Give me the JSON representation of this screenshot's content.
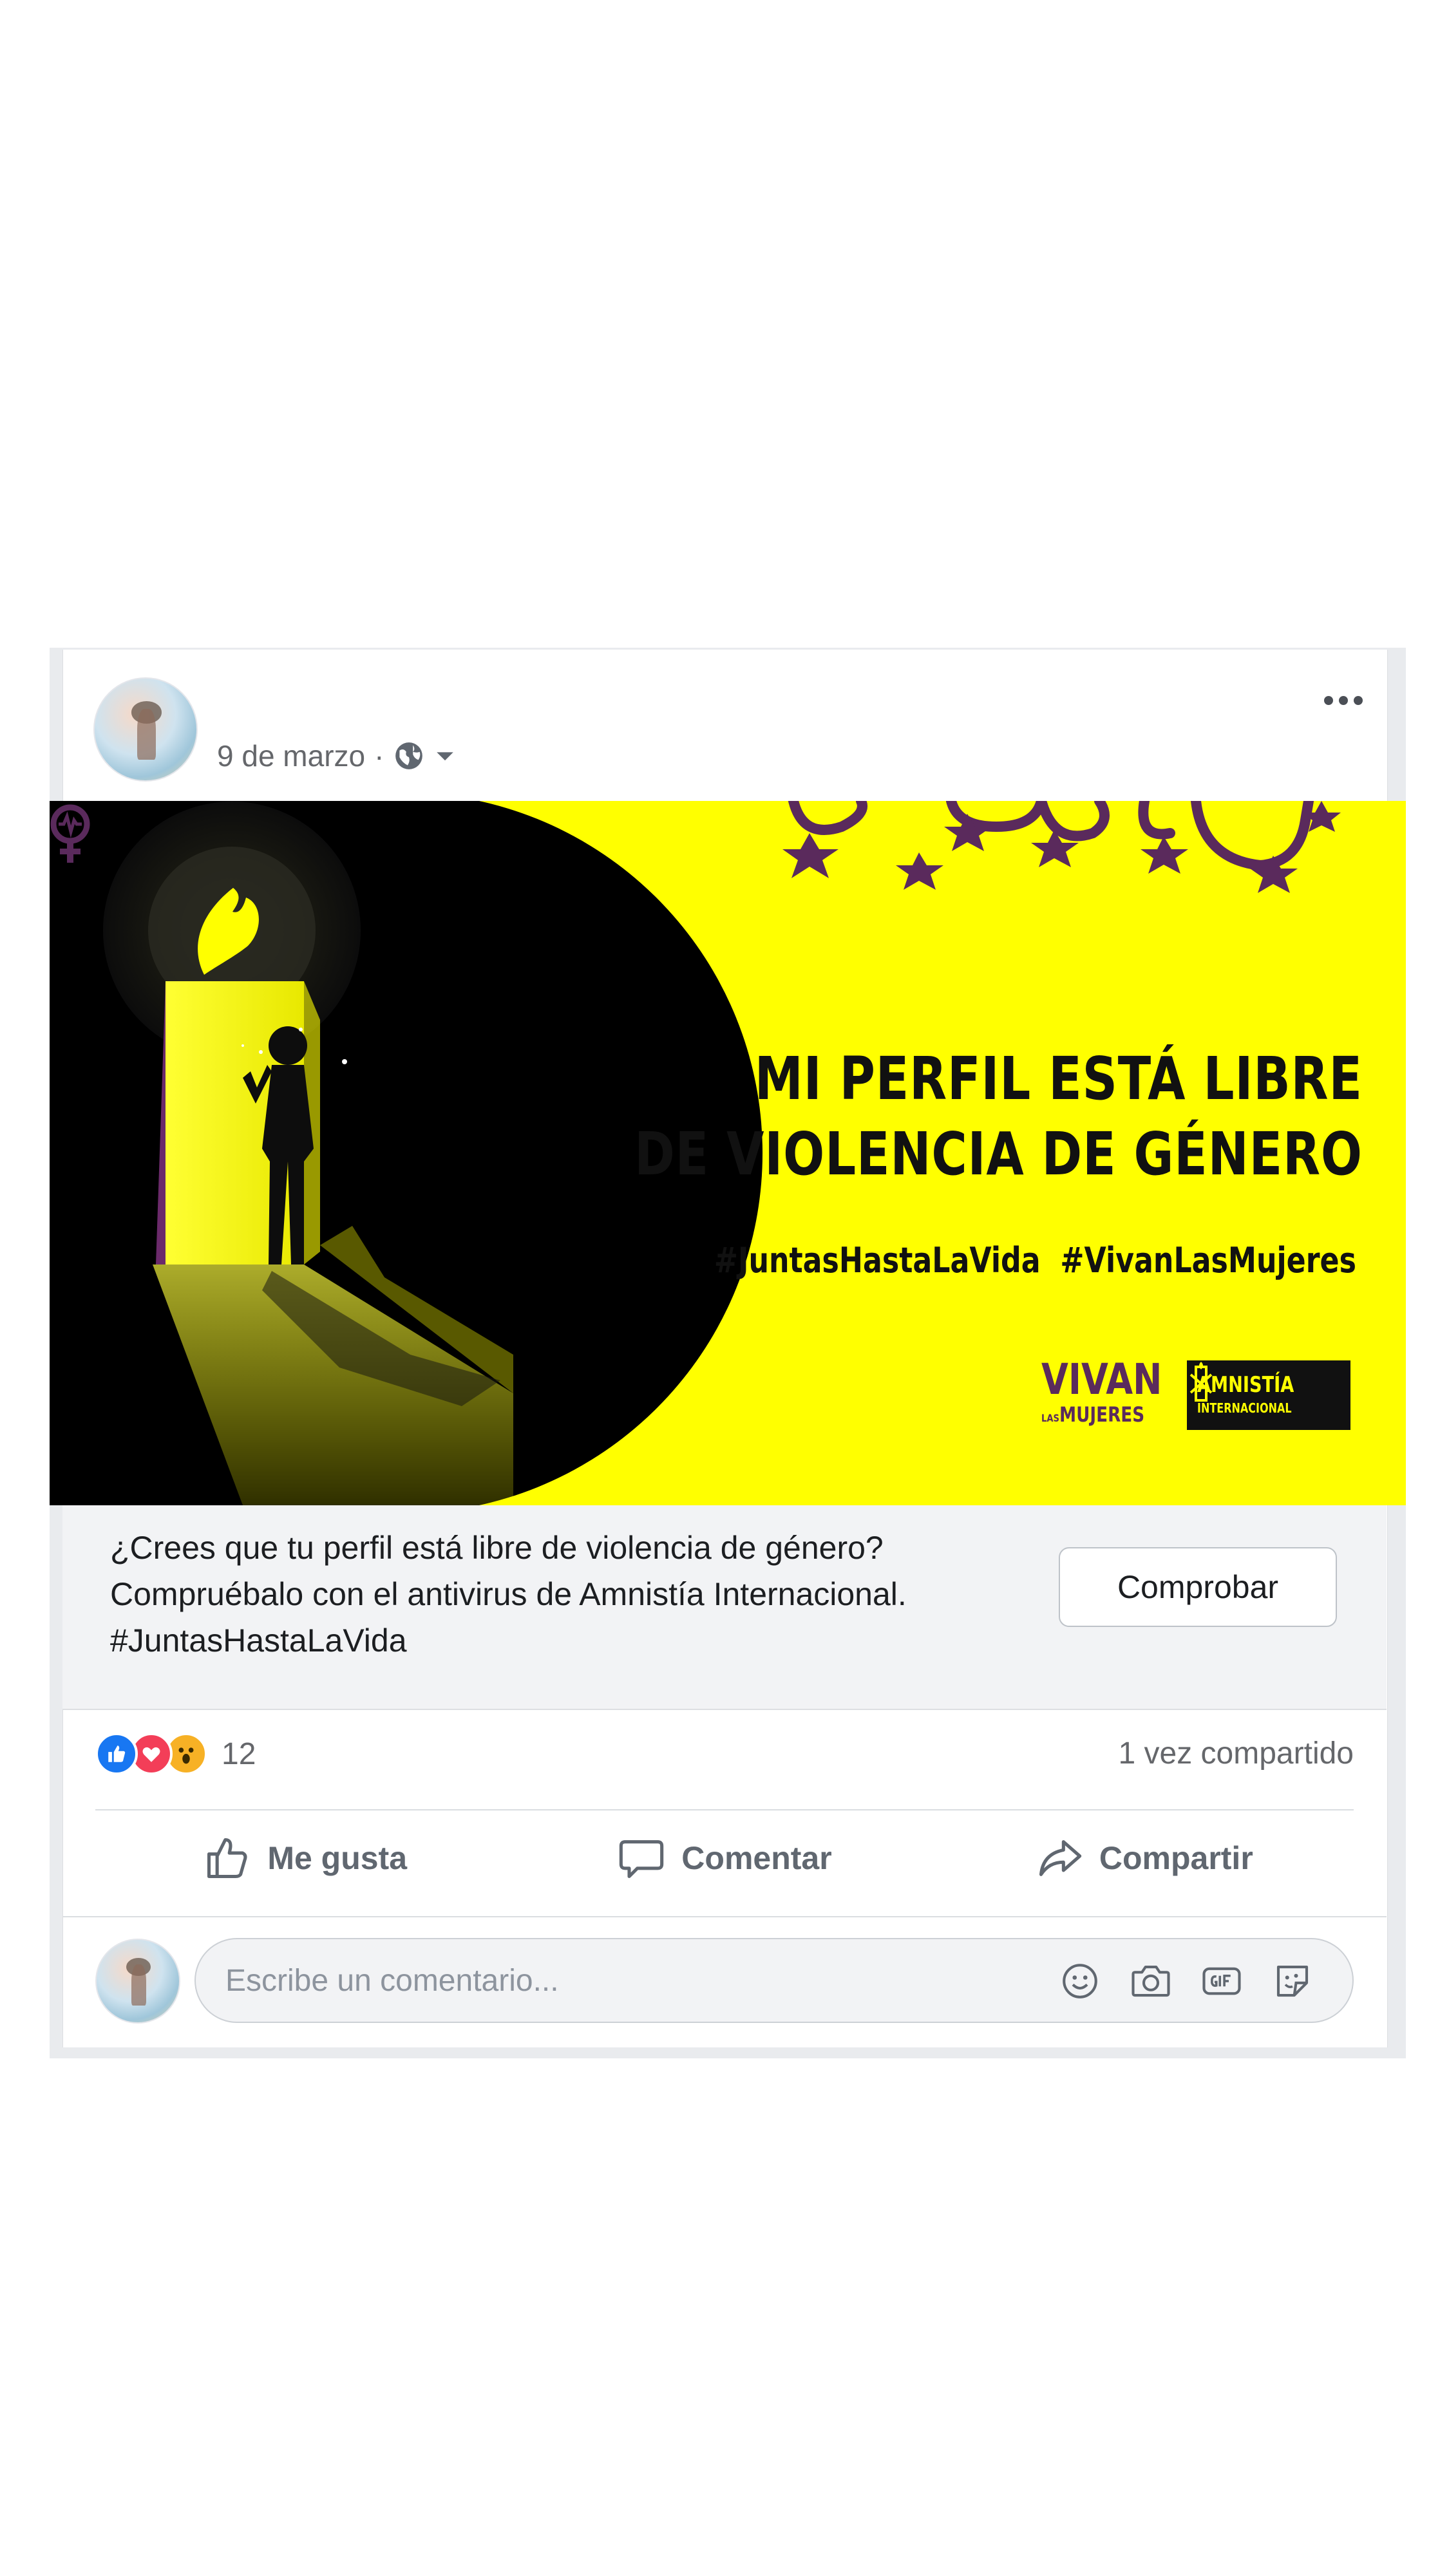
{
  "post": {
    "date": "9 de marzo",
    "separator": "·",
    "privacy_icon": "globe-icon",
    "privacy_menu_icon": "caret-down-icon",
    "more_icon": "more-options-icon"
  },
  "banner": {
    "headline_line1": "MI PERFIL ESTÁ LIBRE",
    "headline_line2": "DE VIOLENCIA DE GÉNERO",
    "hashtags": "#JuntasHastaLaVida  #VivanLasMujeres",
    "logo_vivan_main": "VIVAN",
    "logo_vivan_las": "LAS",
    "logo_vivan_sub": "MUJERES",
    "logo_amnesty_line1": "AMNISTÍA",
    "logo_amnesty_line2": "INTERNACIONAL",
    "colors": {
      "background": "#ffff00",
      "purple": "#5a2a5c",
      "dark": "#111111"
    }
  },
  "description": {
    "line1": "¿Crees que tu perfil está libre de violencia de género?",
    "line2": "Compruébalo con el antivirus de Amnistía Internacional.",
    "line3": "#JuntasHastaLaVida",
    "button_label": "Comprobar"
  },
  "engagement": {
    "reaction_icons": [
      "like-reaction-icon",
      "love-reaction-icon",
      "wow-reaction-icon"
    ],
    "reaction_count": "12",
    "shares": "1 vez compartido"
  },
  "actions": {
    "like": "Me gusta",
    "comment": "Comentar",
    "share": "Compartir"
  },
  "comment_box": {
    "placeholder": "Escribe un comentario...",
    "icons": [
      "emoji-icon",
      "camera-icon",
      "gif-icon",
      "sticker-icon"
    ]
  },
  "colors": {
    "facebook_blue": "#1877f2",
    "love_red": "#f33e58",
    "wow_yellow": "#f7b125",
    "secondary_text": "#65676b"
  }
}
